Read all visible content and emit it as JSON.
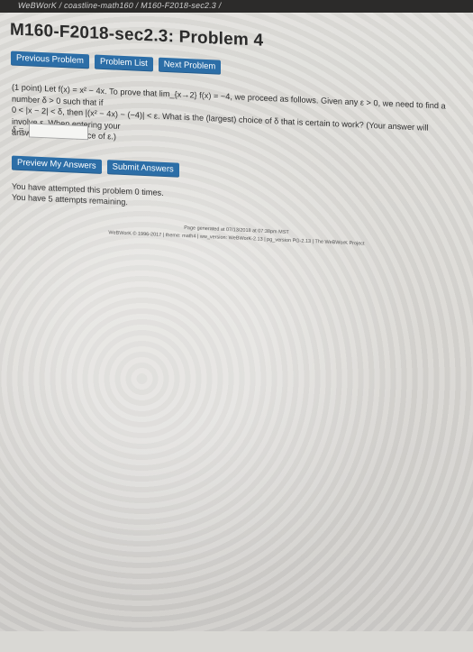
{
  "breadcrumb": "WeBWorK / coastline-math160 / M160-F2018-sec2.3 /",
  "page_title": "M160-F2018-sec2.3: Problem 4",
  "nav_buttons": {
    "previous": "Previous Problem",
    "list": "Problem List",
    "next": "Next Problem"
  },
  "problem": {
    "line1": "(1 point) Let f(x) = x² − 4x. To prove that lim_{x→2} f(x) = −4, we proceed as follows. Given any ε > 0, we need to find a number δ > 0 such that if",
    "line2": "0 < |x − 2| < δ, then |(x² − 4x) − (−4)| < ε. What is the (largest) choice of δ that is certain to work? (Your answer will involve ε. When entering your",
    "line3": "answer, type e in place of ε.)"
  },
  "answer": {
    "label": "δ =",
    "value": ""
  },
  "action_buttons": {
    "preview": "Preview My Answers",
    "submit": "Submit Answers"
  },
  "status": {
    "attempted": "You have attempted this problem 0 times.",
    "remaining": "You have 5 attempts remaining."
  },
  "footer": {
    "generated": "Page generated at 07/13/2018 at 07:38pm MST",
    "copyright": "WeBWorK © 1996-2017 | theme: math4 | ww_version: WeBWorK-2.13 | pg_version PG-2.13 | The WeBWorK Project"
  }
}
